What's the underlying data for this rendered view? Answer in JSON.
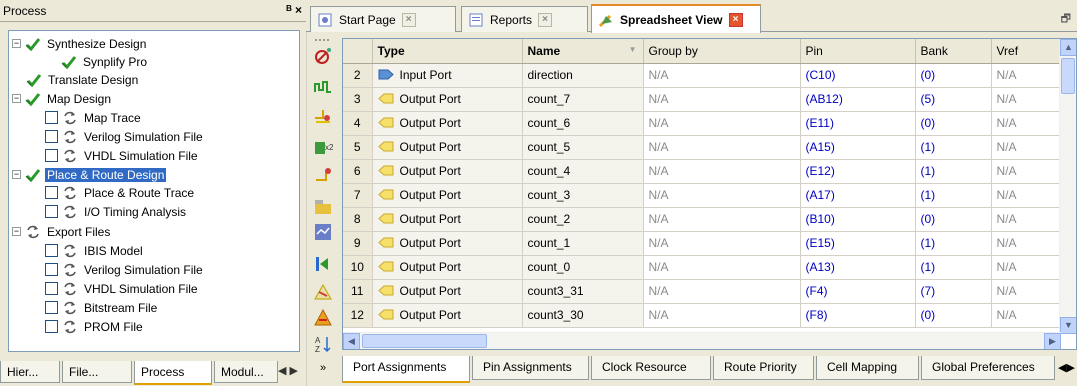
{
  "left_panel": {
    "title": "Process",
    "controls": "ᴮ ×",
    "tree": [
      {
        "label": "Synthesize Design",
        "depth": 0,
        "expander": "−",
        "icon": "check-icon"
      },
      {
        "label": "Synplify Pro",
        "depth": 1,
        "icon": "check-icon"
      },
      {
        "label": "Translate Design",
        "depth": 0,
        "icon": "check-icon"
      },
      {
        "label": "Map Design",
        "depth": 0,
        "expander": "−",
        "icon": "check-icon"
      },
      {
        "label": "Map Trace",
        "depth": 1,
        "checkbox": true,
        "icon": "refresh-icon"
      },
      {
        "label": "Verilog Simulation File",
        "depth": 1,
        "checkbox": true,
        "icon": "refresh-icon"
      },
      {
        "label": "VHDL Simulation File",
        "depth": 1,
        "checkbox": true,
        "icon": "refresh-icon"
      },
      {
        "label": "Place & Route Design",
        "depth": 0,
        "expander": "−",
        "icon": "check-icon",
        "selected": true
      },
      {
        "label": "Place & Route Trace",
        "depth": 1,
        "checkbox": true,
        "icon": "refresh-icon"
      },
      {
        "label": "I/O Timing Analysis",
        "depth": 1,
        "checkbox": true,
        "icon": "refresh-icon"
      },
      {
        "label": "Export Files",
        "depth": 0,
        "expander": "−",
        "icon": "refresh-icon"
      },
      {
        "label": "IBIS Model",
        "depth": 1,
        "checkbox": true,
        "icon": "refresh-icon"
      },
      {
        "label": "Verilog Simulation File",
        "depth": 1,
        "checkbox": true,
        "icon": "refresh-icon"
      },
      {
        "label": "VHDL Simulation File",
        "depth": 1,
        "checkbox": true,
        "icon": "refresh-icon"
      },
      {
        "label": "Bitstream File",
        "depth": 1,
        "checkbox": true,
        "icon": "refresh-icon"
      },
      {
        "label": "PROM File",
        "depth": 1,
        "checkbox": true,
        "icon": "refresh-icon"
      }
    ],
    "tabs": [
      "Hier...",
      "File...",
      "Process",
      "Modul..."
    ]
  },
  "editor_tabs": [
    {
      "label": "Start Page",
      "icon": "start-page-icon"
    },
    {
      "label": "Reports",
      "icon": "reports-icon"
    },
    {
      "label": "Spreadsheet View",
      "icon": "spreadsheet-icon",
      "active": true
    }
  ],
  "sheet": {
    "columns": [
      "",
      "Type",
      "Name",
      "Group by",
      "Pin",
      "Bank",
      "Vref"
    ],
    "rows": [
      {
        "n": "2",
        "type": "Input Port",
        "name": "direction",
        "group": "N/A",
        "pin": "(C10)",
        "bank": "(0)",
        "vref": "N/A"
      },
      {
        "n": "3",
        "type": "Output Port",
        "name": "count_7",
        "group": "N/A",
        "pin": "(AB12)",
        "bank": "(5)",
        "vref": "N/A"
      },
      {
        "n": "4",
        "type": "Output Port",
        "name": "count_6",
        "group": "N/A",
        "pin": "(E11)",
        "bank": "(0)",
        "vref": "N/A"
      },
      {
        "n": "5",
        "type": "Output Port",
        "name": "count_5",
        "group": "N/A",
        "pin": "(A15)",
        "bank": "(1)",
        "vref": "N/A"
      },
      {
        "n": "6",
        "type": "Output Port",
        "name": "count_4",
        "group": "N/A",
        "pin": "(E12)",
        "bank": "(1)",
        "vref": "N/A"
      },
      {
        "n": "7",
        "type": "Output Port",
        "name": "count_3",
        "group": "N/A",
        "pin": "(A17)",
        "bank": "(1)",
        "vref": "N/A"
      },
      {
        "n": "8",
        "type": "Output Port",
        "name": "count_2",
        "group": "N/A",
        "pin": "(B10)",
        "bank": "(0)",
        "vref": "N/A"
      },
      {
        "n": "9",
        "type": "Output Port",
        "name": "count_1",
        "group": "N/A",
        "pin": "(E15)",
        "bank": "(1)",
        "vref": "N/A"
      },
      {
        "n": "10",
        "type": "Output Port",
        "name": "count_0",
        "group": "N/A",
        "pin": "(A13)",
        "bank": "(1)",
        "vref": "N/A"
      },
      {
        "n": "11",
        "type": "Output Port",
        "name": "count3_31",
        "group": "N/A",
        "pin": "(F4)",
        "bank": "(7)",
        "vref": "N/A"
      },
      {
        "n": "12",
        "type": "Output Port",
        "name": "count3_30",
        "group": "N/A",
        "pin": "(F8)",
        "bank": "(0)",
        "vref": "N/A"
      }
    ]
  },
  "sheet_tabs": [
    "Port Assignments",
    "Pin Assignments",
    "Clock Resource",
    "Route Priority",
    "Cell Mapping",
    "Global Preferences"
  ],
  "colors": {
    "selection": "#316ac5",
    "link_blue": "#0000c0",
    "active_tab_accent": "#e68b2c"
  }
}
